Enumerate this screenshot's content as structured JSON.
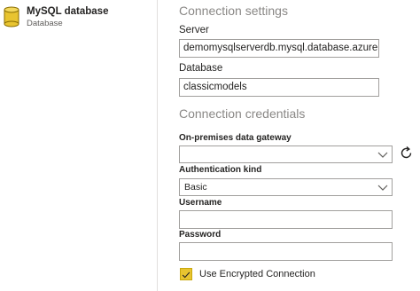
{
  "connector": {
    "name": "MySQL database",
    "type": "Database",
    "icon": "database-icon"
  },
  "connection_settings": {
    "title": "Connection settings",
    "server_label": "Server",
    "server_value": "demomysqlserverdb.mysql.database.azure.",
    "database_label": "Database",
    "database_value": "classicmodels"
  },
  "credentials": {
    "title": "Connection credentials",
    "gateway_label": "On-premises data gateway",
    "gateway_value": "",
    "auth_label": "Authentication kind",
    "auth_value": "Basic",
    "username_label": "Username",
    "username_value": "",
    "password_label": "Password",
    "password_value": "",
    "encrypted_label": "Use Encrypted Connection",
    "encrypted_checked": true
  },
  "colors": {
    "accent_checkbox": "#e8c430",
    "icon_fill": "#e8c430",
    "divider": "#e1dfdd"
  }
}
